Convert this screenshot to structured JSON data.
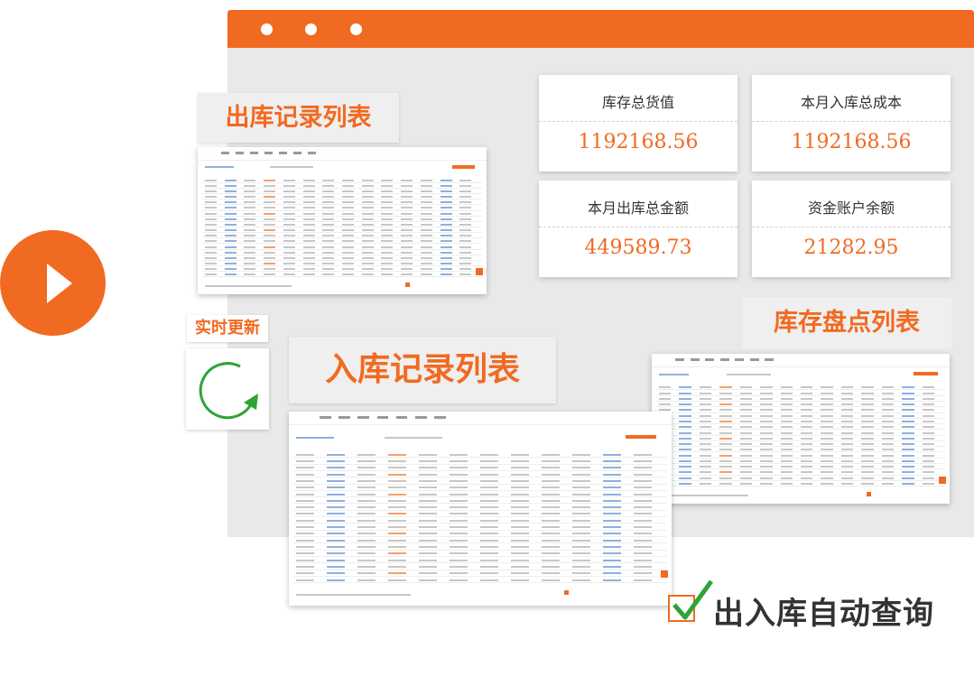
{
  "titles": {
    "outbound": "出库记录列表",
    "inbound": "入库记录列表",
    "inventory": "库存盘点列表",
    "realtime": "实时更新",
    "auto_query": "出入库自动查询"
  },
  "stats": [
    {
      "label": "库存总货值",
      "value": "1192168.56"
    },
    {
      "label": "本月入库总成本",
      "value": "1192168.56"
    },
    {
      "label": "本月出库总金额",
      "value": "449589.73"
    },
    {
      "label": "资金账户余额",
      "value": "21282.95"
    }
  ],
  "colors": {
    "accent": "#f16a21",
    "check": "#2ea337",
    "frame": "#e9e9e9"
  },
  "icons": {
    "play": "play-icon",
    "refresh": "refresh-arrow-icon",
    "check": "checkmark-icon"
  }
}
